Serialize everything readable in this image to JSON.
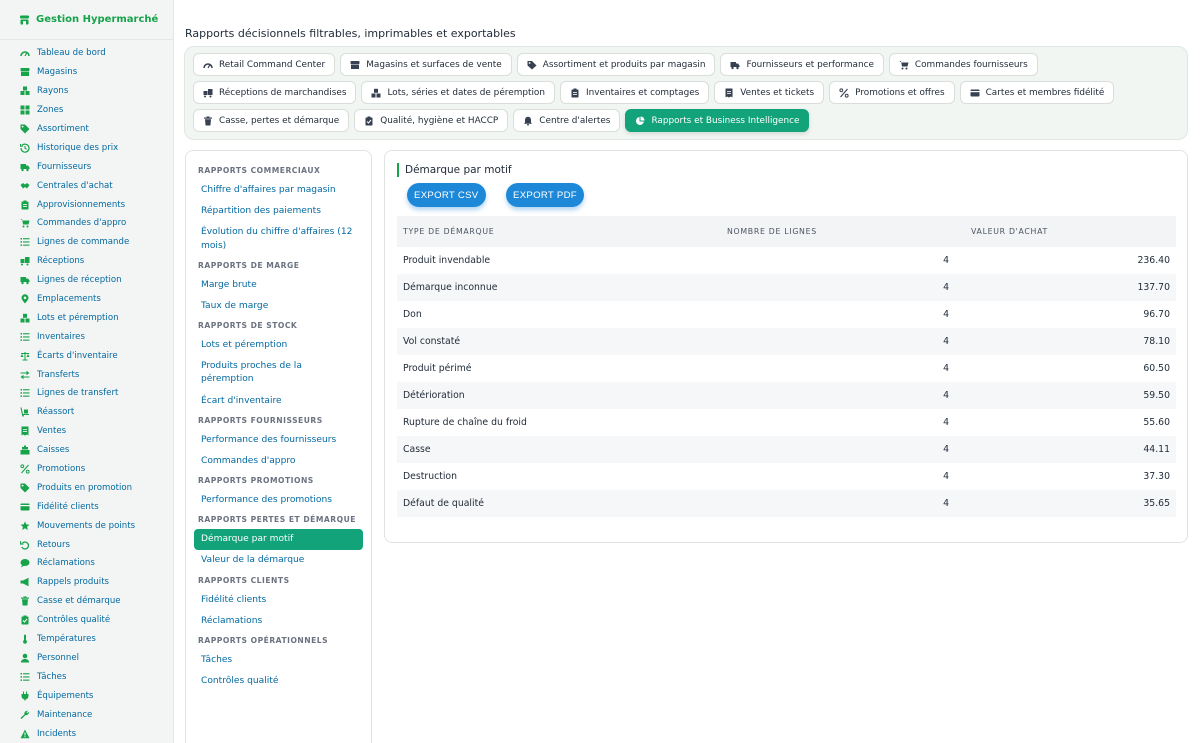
{
  "brand": {
    "title": "Gestion Hypermarché"
  },
  "sidebar": {
    "items": [
      {
        "label": "Tableau de bord",
        "icon": "gauge-icon"
      },
      {
        "label": "Magasins",
        "icon": "store-icon"
      },
      {
        "label": "Rayons",
        "icon": "boxes-icon"
      },
      {
        "label": "Zones",
        "icon": "grid-icon"
      },
      {
        "label": "Assortiment",
        "icon": "tag-icon"
      },
      {
        "label": "Historique des prix",
        "icon": "history-icon"
      },
      {
        "label": "Fournisseurs",
        "icon": "truck-icon"
      },
      {
        "label": "Centrales d'achat",
        "icon": "handshake-icon"
      },
      {
        "label": "Approvisionnements",
        "icon": "clipboard-icon"
      },
      {
        "label": "Commandes d'appro",
        "icon": "cart-icon"
      },
      {
        "label": "Lignes de commande",
        "icon": "list-icon"
      },
      {
        "label": "Réceptions",
        "icon": "truck-loading-icon"
      },
      {
        "label": "Lignes de réception",
        "icon": "truck-icon"
      },
      {
        "label": "Emplacements",
        "icon": "pin-icon"
      },
      {
        "label": "Lots et péremption",
        "icon": "cubes-icon"
      },
      {
        "label": "Inventaires",
        "icon": "list-icon"
      },
      {
        "label": "Écarts d'inventaire",
        "icon": "scale-icon"
      },
      {
        "label": "Transferts",
        "icon": "arrows-icon"
      },
      {
        "label": "Lignes de transfert",
        "icon": "list-icon"
      },
      {
        "label": "Réassort",
        "icon": "dolly-icon"
      },
      {
        "label": "Ventes",
        "icon": "receipt-icon"
      },
      {
        "label": "Caisses",
        "icon": "cash-register-icon"
      },
      {
        "label": "Promotions",
        "icon": "percent-icon"
      },
      {
        "label": "Produits en promotion",
        "icon": "tag-icon"
      },
      {
        "label": "Fidélité clients",
        "icon": "card-icon"
      },
      {
        "label": "Mouvements de points",
        "icon": "star-icon"
      },
      {
        "label": "Retours",
        "icon": "undo-icon"
      },
      {
        "label": "Réclamations",
        "icon": "comment-icon"
      },
      {
        "label": "Rappels produits",
        "icon": "bullhorn-icon"
      },
      {
        "label": "Casse et démarque",
        "icon": "trash-icon"
      },
      {
        "label": "Contrôles qualité",
        "icon": "clipboard-check-icon"
      },
      {
        "label": "Températures",
        "icon": "thermometer-icon"
      },
      {
        "label": "Personnel",
        "icon": "user-icon"
      },
      {
        "label": "Tâches",
        "icon": "list-icon"
      },
      {
        "label": "Équipements",
        "icon": "plug-icon"
      },
      {
        "label": "Maintenance",
        "icon": "wrench-icon"
      },
      {
        "label": "Incidents",
        "icon": "warning-icon"
      }
    ]
  },
  "header": {
    "title": "Rapports décisionnels filtrables, imprimables et exportables"
  },
  "tabs": {
    "rows": [
      [
        {
          "label": "Retail Command Center",
          "icon": "gauge-icon"
        },
        {
          "label": "Magasins et surfaces de vente",
          "icon": "store-icon"
        },
        {
          "label": "Assortiment et produits par magasin",
          "icon": "tags-icon"
        },
        {
          "label": "Fournisseurs et performance",
          "icon": "truck-icon"
        },
        {
          "label": "Commandes fournisseurs",
          "icon": "cart-icon"
        }
      ],
      [
        {
          "label": "Réceptions de marchandises",
          "icon": "truck-loading-icon"
        },
        {
          "label": "Lots, séries et dates de péremption",
          "icon": "cubes-icon"
        },
        {
          "label": "Inventaires et comptages",
          "icon": "clipboard-icon"
        },
        {
          "label": "Ventes et tickets",
          "icon": "receipt-icon"
        },
        {
          "label": "Promotions et offres",
          "icon": "percent-icon"
        },
        {
          "label": "Cartes et membres fidélité",
          "icon": "card-icon"
        }
      ],
      [
        {
          "label": "Casse, pertes et démarque",
          "icon": "trash-icon"
        },
        {
          "label": "Qualité, hygiène et HACCP",
          "icon": "clipboard-check-icon"
        },
        {
          "label": "Centre d'alertes",
          "icon": "bell-icon"
        },
        {
          "label": "Rapports et Business Intelligence",
          "icon": "chart-pie-icon",
          "active": true
        }
      ]
    ]
  },
  "reports": {
    "groups": [
      {
        "title": "Rapports commerciaux",
        "items": [
          "Chiffre d'affaires par magasin",
          "Répartition des paiements",
          "Évolution du chiffre d'affaires (12 mois)"
        ]
      },
      {
        "title": "Rapports de marge",
        "items": [
          "Marge brute",
          "Taux de marge"
        ]
      },
      {
        "title": "Rapports de stock",
        "items": [
          "Lots et péremption",
          "Produits proches de la péremption",
          "Écart d'inventaire"
        ]
      },
      {
        "title": "Rapports fournisseurs",
        "items": [
          "Performance des fournisseurs",
          "Commandes d'appro"
        ]
      },
      {
        "title": "Rapports promotions",
        "items": [
          "Performance des promotions"
        ]
      },
      {
        "title": "Rapports pertes et démarque",
        "items": [
          "Démarque par motif",
          "Valeur de la démarque"
        ],
        "active_index": 0
      },
      {
        "title": "Rapports clients",
        "items": [
          "Fidélité clients",
          "Réclamations"
        ]
      },
      {
        "title": "Rapports opérationnels",
        "items": [
          "Tâches",
          "Contrôles qualité"
        ]
      }
    ]
  },
  "content": {
    "title": "Démarque par motif",
    "export_csv": "EXPORT CSV",
    "export_pdf": "EXPORT PDF",
    "columns": [
      "TYPE DE DÉMARQUE",
      "NOMBRE DE LIGNES",
      "VALEUR D'ACHAT"
    ],
    "rows": [
      [
        "Produit invendable",
        "4",
        "236.40"
      ],
      [
        "Démarque inconnue",
        "4",
        "137.70"
      ],
      [
        "Don",
        "4",
        "96.70"
      ],
      [
        "Vol constaté",
        "4",
        "78.10"
      ],
      [
        "Produit périmé",
        "4",
        "60.50"
      ],
      [
        "Détérioration",
        "4",
        "59.50"
      ],
      [
        "Rupture de chaîne du froid",
        "4",
        "55.60"
      ],
      [
        "Casse",
        "4",
        "44.11"
      ],
      [
        "Destruction",
        "4",
        "37.30"
      ],
      [
        "Défaut de qualité",
        "4",
        "35.65"
      ]
    ]
  },
  "colors": {
    "accent": "#12a37a",
    "sidebar_icon": "#16a34a",
    "link": "#0369a1",
    "button": "#1e88d8"
  }
}
